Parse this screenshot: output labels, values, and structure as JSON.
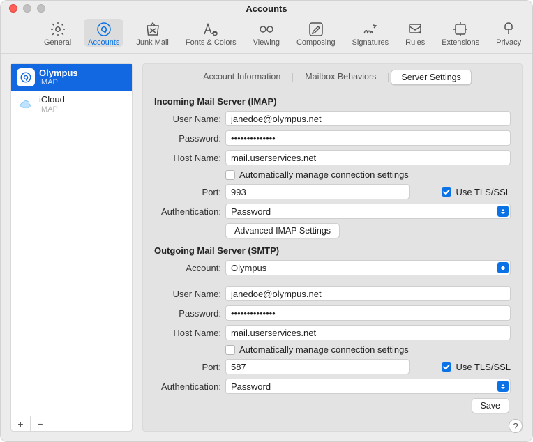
{
  "window": {
    "title": "Accounts"
  },
  "toolbar": [
    {
      "id": "general",
      "label": "General"
    },
    {
      "id": "accounts",
      "label": "Accounts"
    },
    {
      "id": "junk",
      "label": "Junk Mail"
    },
    {
      "id": "fonts",
      "label": "Fonts & Colors"
    },
    {
      "id": "viewing",
      "label": "Viewing"
    },
    {
      "id": "composing",
      "label": "Composing"
    },
    {
      "id": "signatures",
      "label": "Signatures"
    },
    {
      "id": "rules",
      "label": "Rules"
    },
    {
      "id": "extensions",
      "label": "Extensions"
    },
    {
      "id": "privacy",
      "label": "Privacy"
    }
  ],
  "active_toolbar": "accounts",
  "accounts": [
    {
      "name": "Olympus",
      "type": "IMAP",
      "icon": "at",
      "selected": true
    },
    {
      "name": "iCloud",
      "type": "IMAP",
      "icon": "cloud",
      "selected": false
    }
  ],
  "tabs": {
    "items": [
      "Account Information",
      "Mailbox Behaviors",
      "Server Settings"
    ],
    "active": "Server Settings"
  },
  "labels": {
    "incoming_title": "Incoming Mail Server (IMAP)",
    "outgoing_title": "Outgoing Mail Server (SMTP)",
    "user": "User Name:",
    "password": "Password:",
    "host": "Host Name:",
    "auto_manage": "Automatically manage connection settings",
    "port": "Port:",
    "tls": "Use TLS/SSL",
    "auth": "Authentication:",
    "advanced_imap": "Advanced IMAP Settings",
    "account": "Account:",
    "save": "Save"
  },
  "incoming": {
    "user": "janedoe@olympus.net",
    "password": "••••••••••••••",
    "host": "mail.userservices.net",
    "auto_manage": false,
    "port": "993",
    "tls": true,
    "auth": "Password"
  },
  "outgoing": {
    "account": "Olympus",
    "user": "janedoe@olympus.net",
    "password": "••••••••••••••",
    "host": "mail.userservices.net",
    "auto_manage": false,
    "port": "587",
    "tls": true,
    "auth": "Password"
  }
}
